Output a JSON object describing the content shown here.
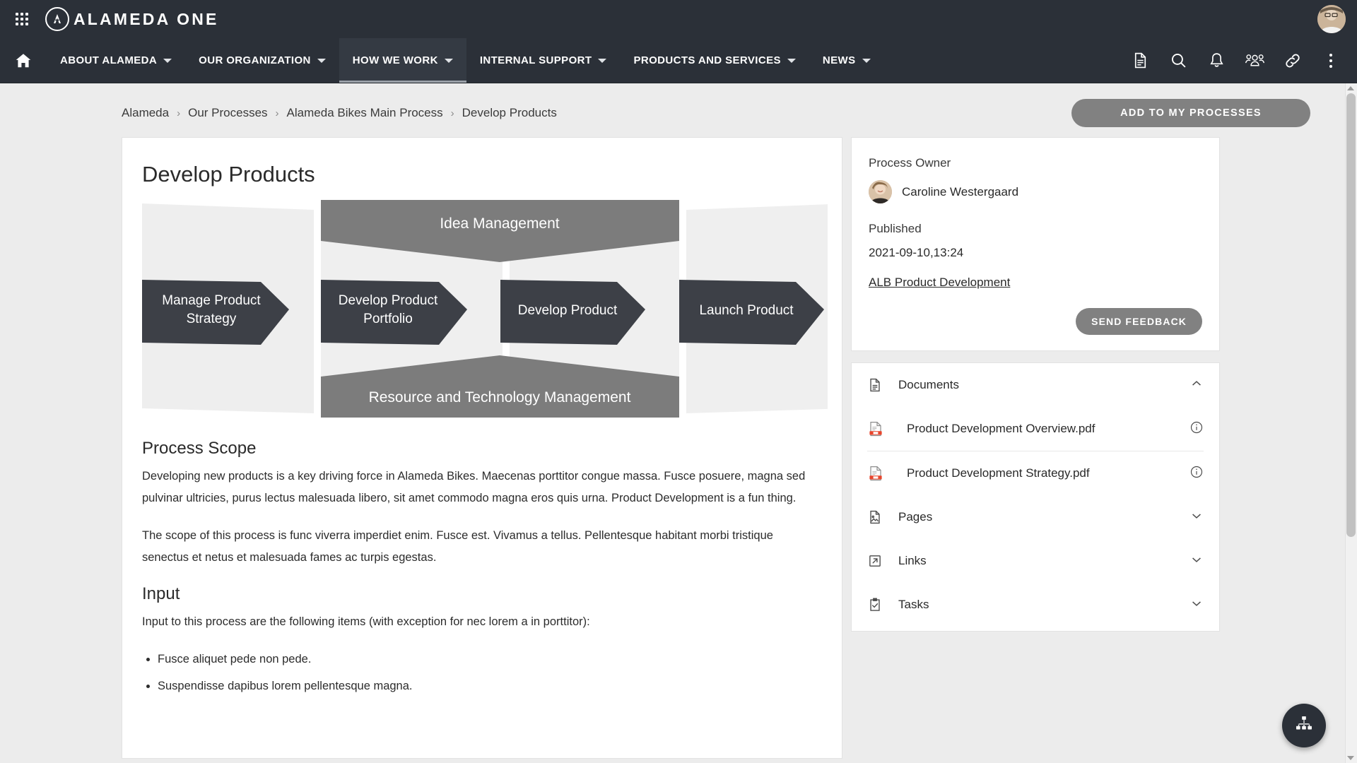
{
  "brand": {
    "name": "ALAMEDA ONE",
    "waffle_icon": "apps-grid-icon",
    "logo_icon": "alameda-circle-logo-icon",
    "avatar_icon": "user-avatar"
  },
  "nav": {
    "home_icon": "home-icon",
    "items": [
      {
        "label": "ABOUT ALAMEDA",
        "active": false
      },
      {
        "label": "OUR ORGANIZATION",
        "active": false
      },
      {
        "label": "HOW WE WORK",
        "active": true
      },
      {
        "label": "INTERNAL SUPPORT",
        "active": false
      },
      {
        "label": "PRODUCTS AND SERVICES",
        "active": false
      },
      {
        "label": "NEWS",
        "active": false
      }
    ],
    "icons": [
      "document-icon",
      "search-icon",
      "bell-icon",
      "people-icon",
      "link-icon",
      "kebab-menu-icon"
    ]
  },
  "breadcrumb": {
    "separator": "›",
    "items": [
      "Alameda",
      "Our Processes",
      "Alameda Bikes Main Process",
      "Develop Products"
    ]
  },
  "actions": {
    "add_to_my_processes": "ADD TO MY PROCESSES",
    "send_feedback": "SEND FEEDBACK"
  },
  "main": {
    "title": "Develop Products",
    "diagram": {
      "core_stages": [
        "Manage Product Strategy",
        "Develop Product Portfolio",
        "Develop Product",
        "Launch Product"
      ],
      "top_band": "Idea Management",
      "bottom_band": "Resource and Technology Management",
      "colors": {
        "core": "#3d4047",
        "band": "#7c7c7c",
        "panel": "#eeeeee"
      }
    },
    "sections": [
      {
        "heading": "Process Scope",
        "paragraphs": [
          "Developing new products is a key driving force in Alameda Bikes. Maecenas porttitor congue massa. Fusce posuere, magna sed pulvinar ultricies, purus lectus malesuada libero, sit amet commodo magna eros quis urna. Product Development is a fun thing.",
          "The scope of this process is func viverra imperdiet enim. Fusce est. Vivamus a tellus. Pellentesque habitant morbi tristique senectus et netus et malesuada fames ac turpis egestas."
        ],
        "bullets": []
      },
      {
        "heading": "Input",
        "paragraphs": [
          "Input to this process are the following items (with exception for nec lorem a in porttitor):"
        ],
        "bullets": [
          "Fusce aliquet pede non pede.",
          "Suspendisse dapibus lorem pellentesque magna."
        ]
      }
    ]
  },
  "sidebar": {
    "owner_label": "Process Owner",
    "owner_name": "Caroline Westergaard",
    "published_label": "Published",
    "published_value": "2021-09-10,13:24",
    "related_link": "ALB Product Development",
    "accordions": [
      {
        "label": "Documents",
        "icon": "document-lines-icon",
        "expanded": true,
        "chevron": "chevron-up-icon"
      },
      {
        "label": "Pages",
        "icon": "page-image-icon",
        "expanded": false,
        "chevron": "chevron-down-icon"
      },
      {
        "label": "Links",
        "icon": "external-link-icon",
        "expanded": false,
        "chevron": "chevron-down-icon"
      },
      {
        "label": "Tasks",
        "icon": "clipboard-check-icon",
        "expanded": false,
        "chevron": "chevron-down-icon"
      }
    ],
    "documents": [
      {
        "name": "Product Development Overview.pdf",
        "icon": "pdf-file-icon",
        "info_icon": "info-icon"
      },
      {
        "name": "Product Development Strategy.pdf",
        "icon": "pdf-file-icon",
        "info_icon": "info-icon"
      }
    ]
  },
  "fab": {
    "icon": "org-chart-icon"
  },
  "theme": {
    "header_bg": "#2b3038",
    "page_bg": "#ececec",
    "button_gray": "#818181",
    "pdf_red": "#e8452c"
  }
}
